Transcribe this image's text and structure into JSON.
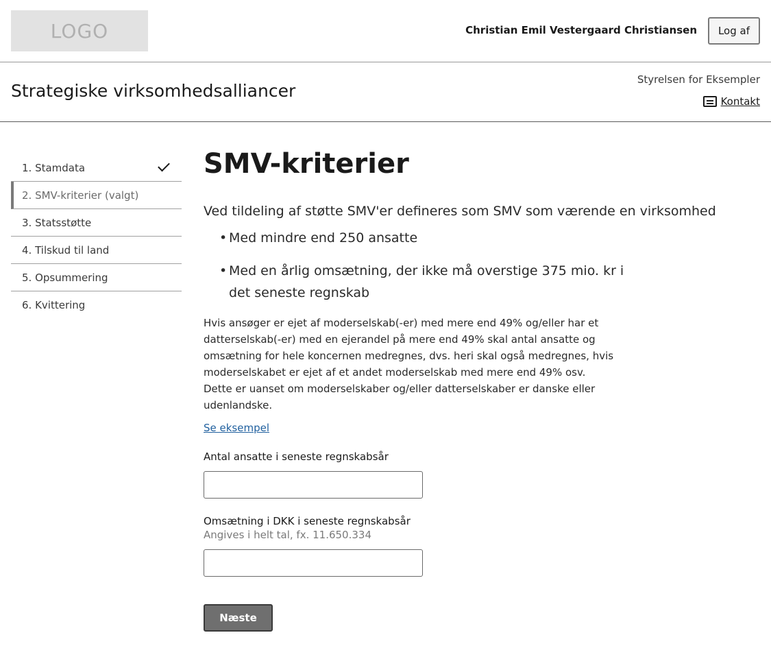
{
  "header": {
    "logo_text": "LOGO",
    "user_name": "Christian Emil Vestergaard Christiansen",
    "logout_label": "Log af"
  },
  "subheader": {
    "site_title": "Strategiske virksomhedsalliancer",
    "authority": "Styrelsen for Eksempler",
    "contact_label": "Kontakt",
    "contact_icon": "contact-card-icon"
  },
  "sidebar": {
    "steps": [
      {
        "label": "1. Stamdata",
        "completed": true
      },
      {
        "label": "2. SMV-kriterier (valgt)",
        "active": true
      },
      {
        "label": "3. Statsstøtte"
      },
      {
        "label": "4. Tilskud til land"
      },
      {
        "label": "5. Opsummering"
      },
      {
        "label": "6. Kvittering"
      }
    ]
  },
  "main": {
    "title": "SMV-kriterier",
    "intro": "Ved tildeling af støtte SMV'er defineres som SMV som værende en virksomhed",
    "bullets": [
      "Med mindre end 250 ansatte",
      "Med en årlig omsætning, der ikke må overstige 375 mio. kr i det seneste regnskab"
    ],
    "description_1": "Hvis ansøger er ejet af moderselskab(-er) med mere end 49% og/eller har et datterselskab(-er) med en ejerandel på mere end 49% skal antal ansatte og omsætning for hele koncernen medregnes, dvs. heri skal også medregnes, hvis moderselskabet er ejet af et andet moderselskab med mere end 49% osv.",
    "description_2": "Dette er uanset om moderselskaber og/eller datterselskaber er danske eller udenlandske.",
    "example_link": "Se eksempel",
    "employees_label": "Antal ansatte i seneste regnskabsår",
    "employees_value": "",
    "revenue_label": "Omsætning i DKK i seneste regnskabsår",
    "revenue_hint": "Angives i helt tal, fx. 11.650.334",
    "revenue_value": "",
    "next_label": "Næste"
  }
}
